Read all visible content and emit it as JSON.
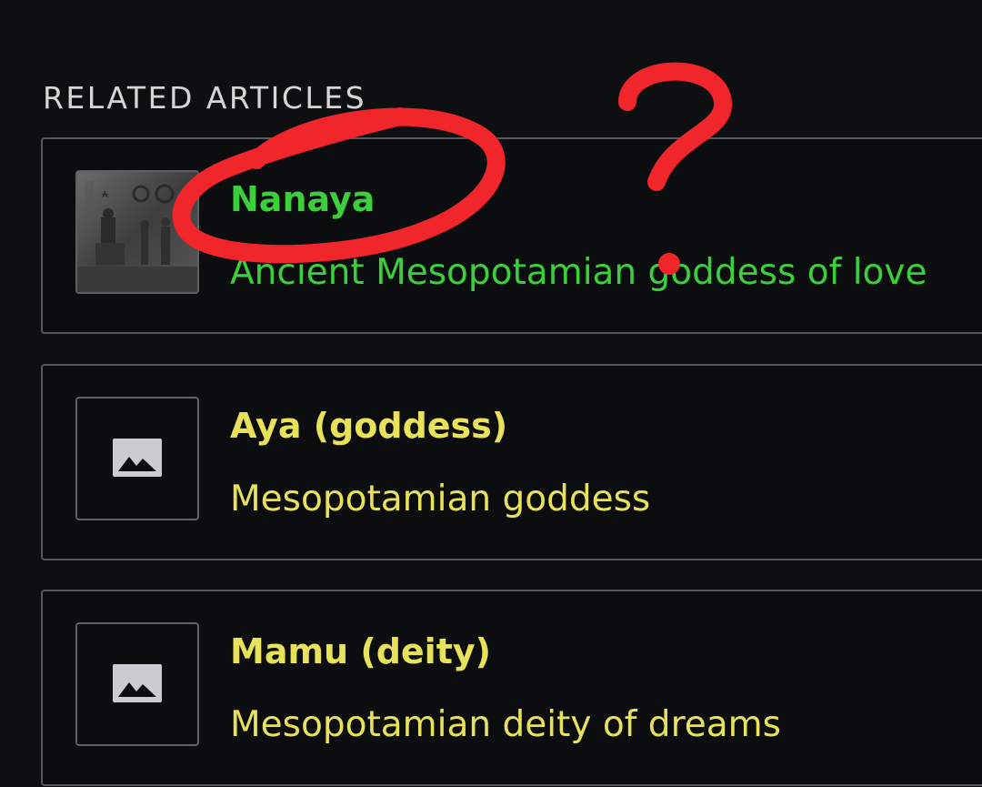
{
  "section": {
    "title": "RELATED ARTICLES"
  },
  "articles": [
    {
      "title": "Nanaya",
      "description": "Ancient Mesopotamian goddess of love",
      "thumbnail": "relief-photo",
      "color": "#3ccf3c"
    },
    {
      "title": "Aya (goddess)",
      "description": "Mesopotamian goddess",
      "thumbnail": "image-placeholder-icon",
      "color": "#e8e25a"
    },
    {
      "title": "Mamu (deity)",
      "description": "Mesopotamian deity of dreams",
      "thumbnail": "image-placeholder-icon",
      "color": "#e8e25a"
    }
  ],
  "annotations": {
    "mark": "?",
    "color": "#f0262b"
  }
}
